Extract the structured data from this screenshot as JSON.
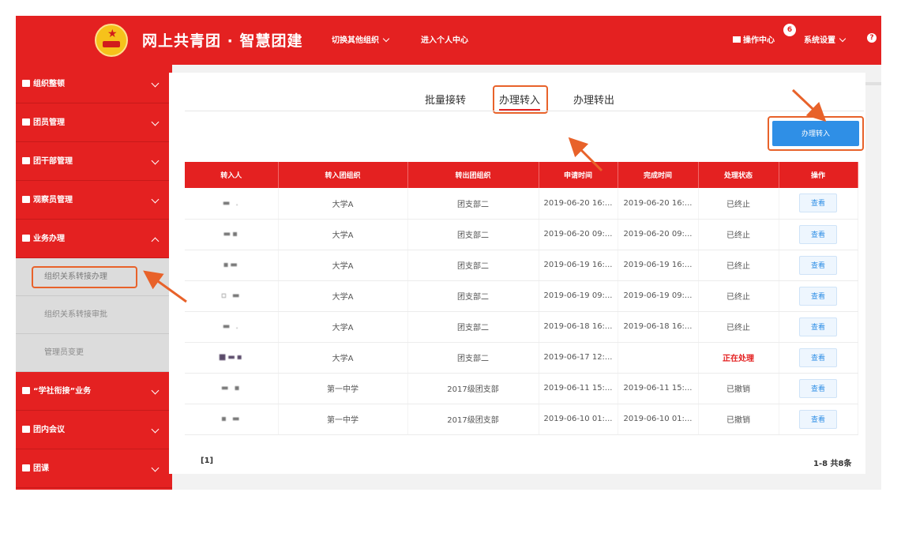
{
  "header": {
    "app_title": "网上共青团 · 智慧团建",
    "switch_org": "切换其他组织",
    "personal_center": "进入个人中心",
    "ops_center": "操作中心",
    "notification_count": "6",
    "system_settings": "系统设置",
    "help": "?"
  },
  "sidebar": {
    "items": [
      {
        "label": "组织整顿"
      },
      {
        "label": "团员管理"
      },
      {
        "label": "团干部管理"
      },
      {
        "label": "观察员管理"
      },
      {
        "label": "业务办理"
      }
    ],
    "subitems": [
      {
        "label": "组织关系转接办理"
      },
      {
        "label": "组织关系转接审批"
      },
      {
        "label": "管理员变更"
      }
    ],
    "items_after": [
      {
        "label": "“学社衔接”业务"
      },
      {
        "label": "团内会议"
      },
      {
        "label": "团课"
      }
    ]
  },
  "tabs": {
    "batch": "批量接转",
    "transfer_in": "办理转入",
    "transfer_out": "办理转出"
  },
  "actions": {
    "transfer_in_button": "办理转入"
  },
  "table": {
    "columns": [
      "转入人",
      "转入团组织",
      "转出团组织",
      "申请时间",
      "完成时间",
      "处理状态",
      "操作"
    ],
    "rows": [
      {
        "org_in": "大学A",
        "org_out": "团支部二",
        "applied": "2019-06-20 16:...",
        "completed": "2019-06-20 16:...",
        "status": "已终止",
        "action": "查看"
      },
      {
        "org_in": "大学A",
        "org_out": "团支部二",
        "applied": "2019-06-20 09:...",
        "completed": "2019-06-20 09:...",
        "status": "已终止",
        "action": "查看"
      },
      {
        "org_in": "大学A",
        "org_out": "团支部二",
        "applied": "2019-06-19 16:...",
        "completed": "2019-06-19 16:...",
        "status": "已终止",
        "action": "查看"
      },
      {
        "org_in": "大学A",
        "org_out": "团支部二",
        "applied": "2019-06-19 09:...",
        "completed": "2019-06-19 09:...",
        "status": "已终止",
        "action": "查看"
      },
      {
        "org_in": "大学A",
        "org_out": "团支部二",
        "applied": "2019-06-18 16:...",
        "completed": "2019-06-18 16:...",
        "status": "已终止",
        "action": "查看"
      },
      {
        "org_in": "大学A",
        "org_out": "团支部二",
        "applied": "2019-06-17 12:...",
        "completed": "",
        "status": "正在处理",
        "action": "查看"
      },
      {
        "org_in": "第一中学",
        "org_out": "2017级团支部",
        "applied": "2019-06-11 15:...",
        "completed": "2019-06-11 15:...",
        "status": "已撤销",
        "action": "查看"
      },
      {
        "org_in": "第一中学",
        "org_out": "2017级团支部",
        "applied": "2019-06-10 01:...",
        "completed": "2019-06-10 01:...",
        "status": "已撤销",
        "action": "查看"
      }
    ]
  },
  "pager": {
    "pages": "[1]",
    "summary": "1-8 共8条"
  },
  "colors": {
    "brand_red": "#e42121",
    "primary_blue": "#2f8fe6",
    "annotation_orange": "#e8622a"
  }
}
